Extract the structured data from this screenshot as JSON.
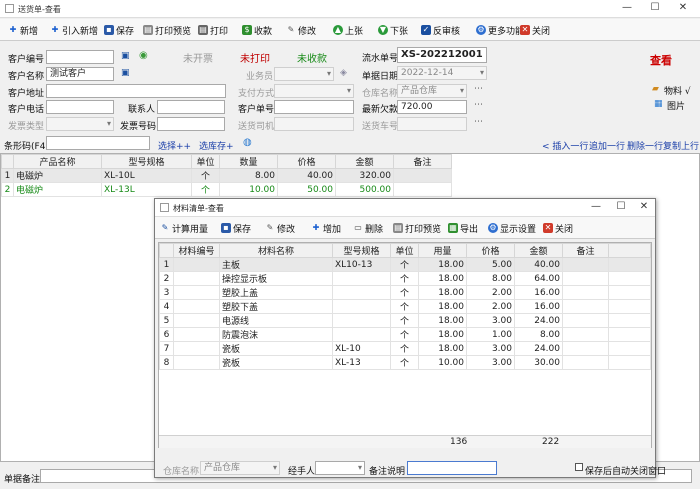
{
  "window": {
    "title": "送货单-查看",
    "min": "—",
    "max": "☐",
    "close": "✕"
  },
  "toolbar": {
    "new": "新增",
    "import": "引入新增",
    "save": "保存",
    "print_preview": "打印预览",
    "print": "打印",
    "receive": "收款",
    "edit": "修改",
    "prev": "上张",
    "next": "下张",
    "unaudit": "反审核",
    "more": "更多功能",
    "close": "关闭"
  },
  "header": {
    "customer_no_label": "客户编号",
    "customer_no": "",
    "status_unopened": "未开票",
    "status_unprinted": "未打印",
    "status_unreceived": "未收款",
    "serial_label": "流水单号",
    "serial": "XS-202212001",
    "customer_name_label": "客户名称",
    "customer_name": "测试客户",
    "salesman_label": "业务员",
    "salesman": "",
    "date_label": "单据日期",
    "date": "2022-12-14",
    "address_label": "客户地址",
    "address": "",
    "pay_label": "支付方式",
    "pay": "",
    "warehouse_label": "仓库名称",
    "warehouse": "产品仓库",
    "phone_label": "客户电话",
    "phone": "",
    "contact_label": "联系人",
    "contact": "",
    "cust_order_label": "客户单号",
    "cust_order": "",
    "debt_label": "最新欠款",
    "debt": "720.00",
    "invoice_type_label": "发票类型",
    "invoice_type": "",
    "invoice_no_label": "发票号码",
    "invoice_no": "",
    "driver_label": "送货司机",
    "driver": "",
    "car_label": "送货车号",
    "car": "",
    "view_stamp": "查看",
    "material_link": "物料 √",
    "image_link": "图片"
  },
  "barcode": {
    "label": "条形码(F4)",
    "value": "",
    "select_plus": "选择++",
    "select_save": "选库存+"
  },
  "row_actions": {
    "insert": "< 插入一行",
    "append": "追加一行",
    "delete": "删除一行",
    "copy": "复制上行"
  },
  "main_grid": {
    "columns": [
      "产品名称",
      "型号规格",
      "单位",
      "数量",
      "价格",
      "金额",
      "备注"
    ],
    "rows": [
      {
        "no": "1",
        "name": "电磁炉",
        "model": "XL-10L",
        "unit": "个",
        "qty": "8.00",
        "price": "40.00",
        "amount": "320.00",
        "note": ""
      },
      {
        "no": "2",
        "name": "电磁炉",
        "model": "XL-13L",
        "unit": "个",
        "qty": "10.00",
        "price": "50.00",
        "amount": "500.00",
        "note": ""
      }
    ]
  },
  "footer": {
    "remark_label": "单据备注",
    "remark": ""
  },
  "dialog": {
    "title": "材料清单-查看",
    "toolbar": {
      "calc": "计算用量",
      "save": "保存",
      "edit": "修改",
      "add": "增加",
      "delete": "删除",
      "print_preview": "打印预览",
      "export": "导出",
      "display": "显示设置",
      "close": "关闭"
    },
    "columns": [
      "材料编号",
      "材料名称",
      "型号规格",
      "单位",
      "用量",
      "价格",
      "金额",
      "备注"
    ],
    "rows": [
      {
        "no": "1",
        "code": "",
        "name": "主板",
        "model": "XL10-13",
        "unit": "个",
        "qty": "18.00",
        "price": "5.00",
        "amount": "40.00",
        "note": ""
      },
      {
        "no": "2",
        "code": "",
        "name": "操控显示板",
        "model": "",
        "unit": "个",
        "qty": "18.00",
        "price": "8.00",
        "amount": "64.00",
        "note": ""
      },
      {
        "no": "3",
        "code": "",
        "name": "塑胶上盖",
        "model": "",
        "unit": "个",
        "qty": "18.00",
        "price": "2.00",
        "amount": "16.00",
        "note": ""
      },
      {
        "no": "4",
        "code": "",
        "name": "塑胶下盖",
        "model": "",
        "unit": "个",
        "qty": "18.00",
        "price": "2.00",
        "amount": "16.00",
        "note": ""
      },
      {
        "no": "5",
        "code": "",
        "name": "电源线",
        "model": "",
        "unit": "个",
        "qty": "18.00",
        "price": "3.00",
        "amount": "24.00",
        "note": ""
      },
      {
        "no": "6",
        "code": "",
        "name": "防震泡沫",
        "model": "",
        "unit": "个",
        "qty": "18.00",
        "price": "1.00",
        "amount": "8.00",
        "note": ""
      },
      {
        "no": "7",
        "code": "",
        "name": "瓷板",
        "model": "XL-10",
        "unit": "个",
        "qty": "18.00",
        "price": "3.00",
        "amount": "24.00",
        "note": ""
      },
      {
        "no": "8",
        "code": "",
        "name": "瓷板",
        "model": "XL-13",
        "unit": "个",
        "qty": "10.00",
        "price": "3.00",
        "amount": "30.00",
        "note": ""
      }
    ],
    "total_qty": "136",
    "total_amount": "222",
    "warehouse_label": "仓库名称",
    "warehouse": "产品仓库",
    "handler_label": "经手人",
    "handler": "",
    "note_label": "备注说明",
    "note": "",
    "autoclose_label": "保存后自动关闭窗口"
  },
  "colors": {
    "accent": "#1a3ea8",
    "green": "#178a17",
    "red": "#c00000"
  }
}
